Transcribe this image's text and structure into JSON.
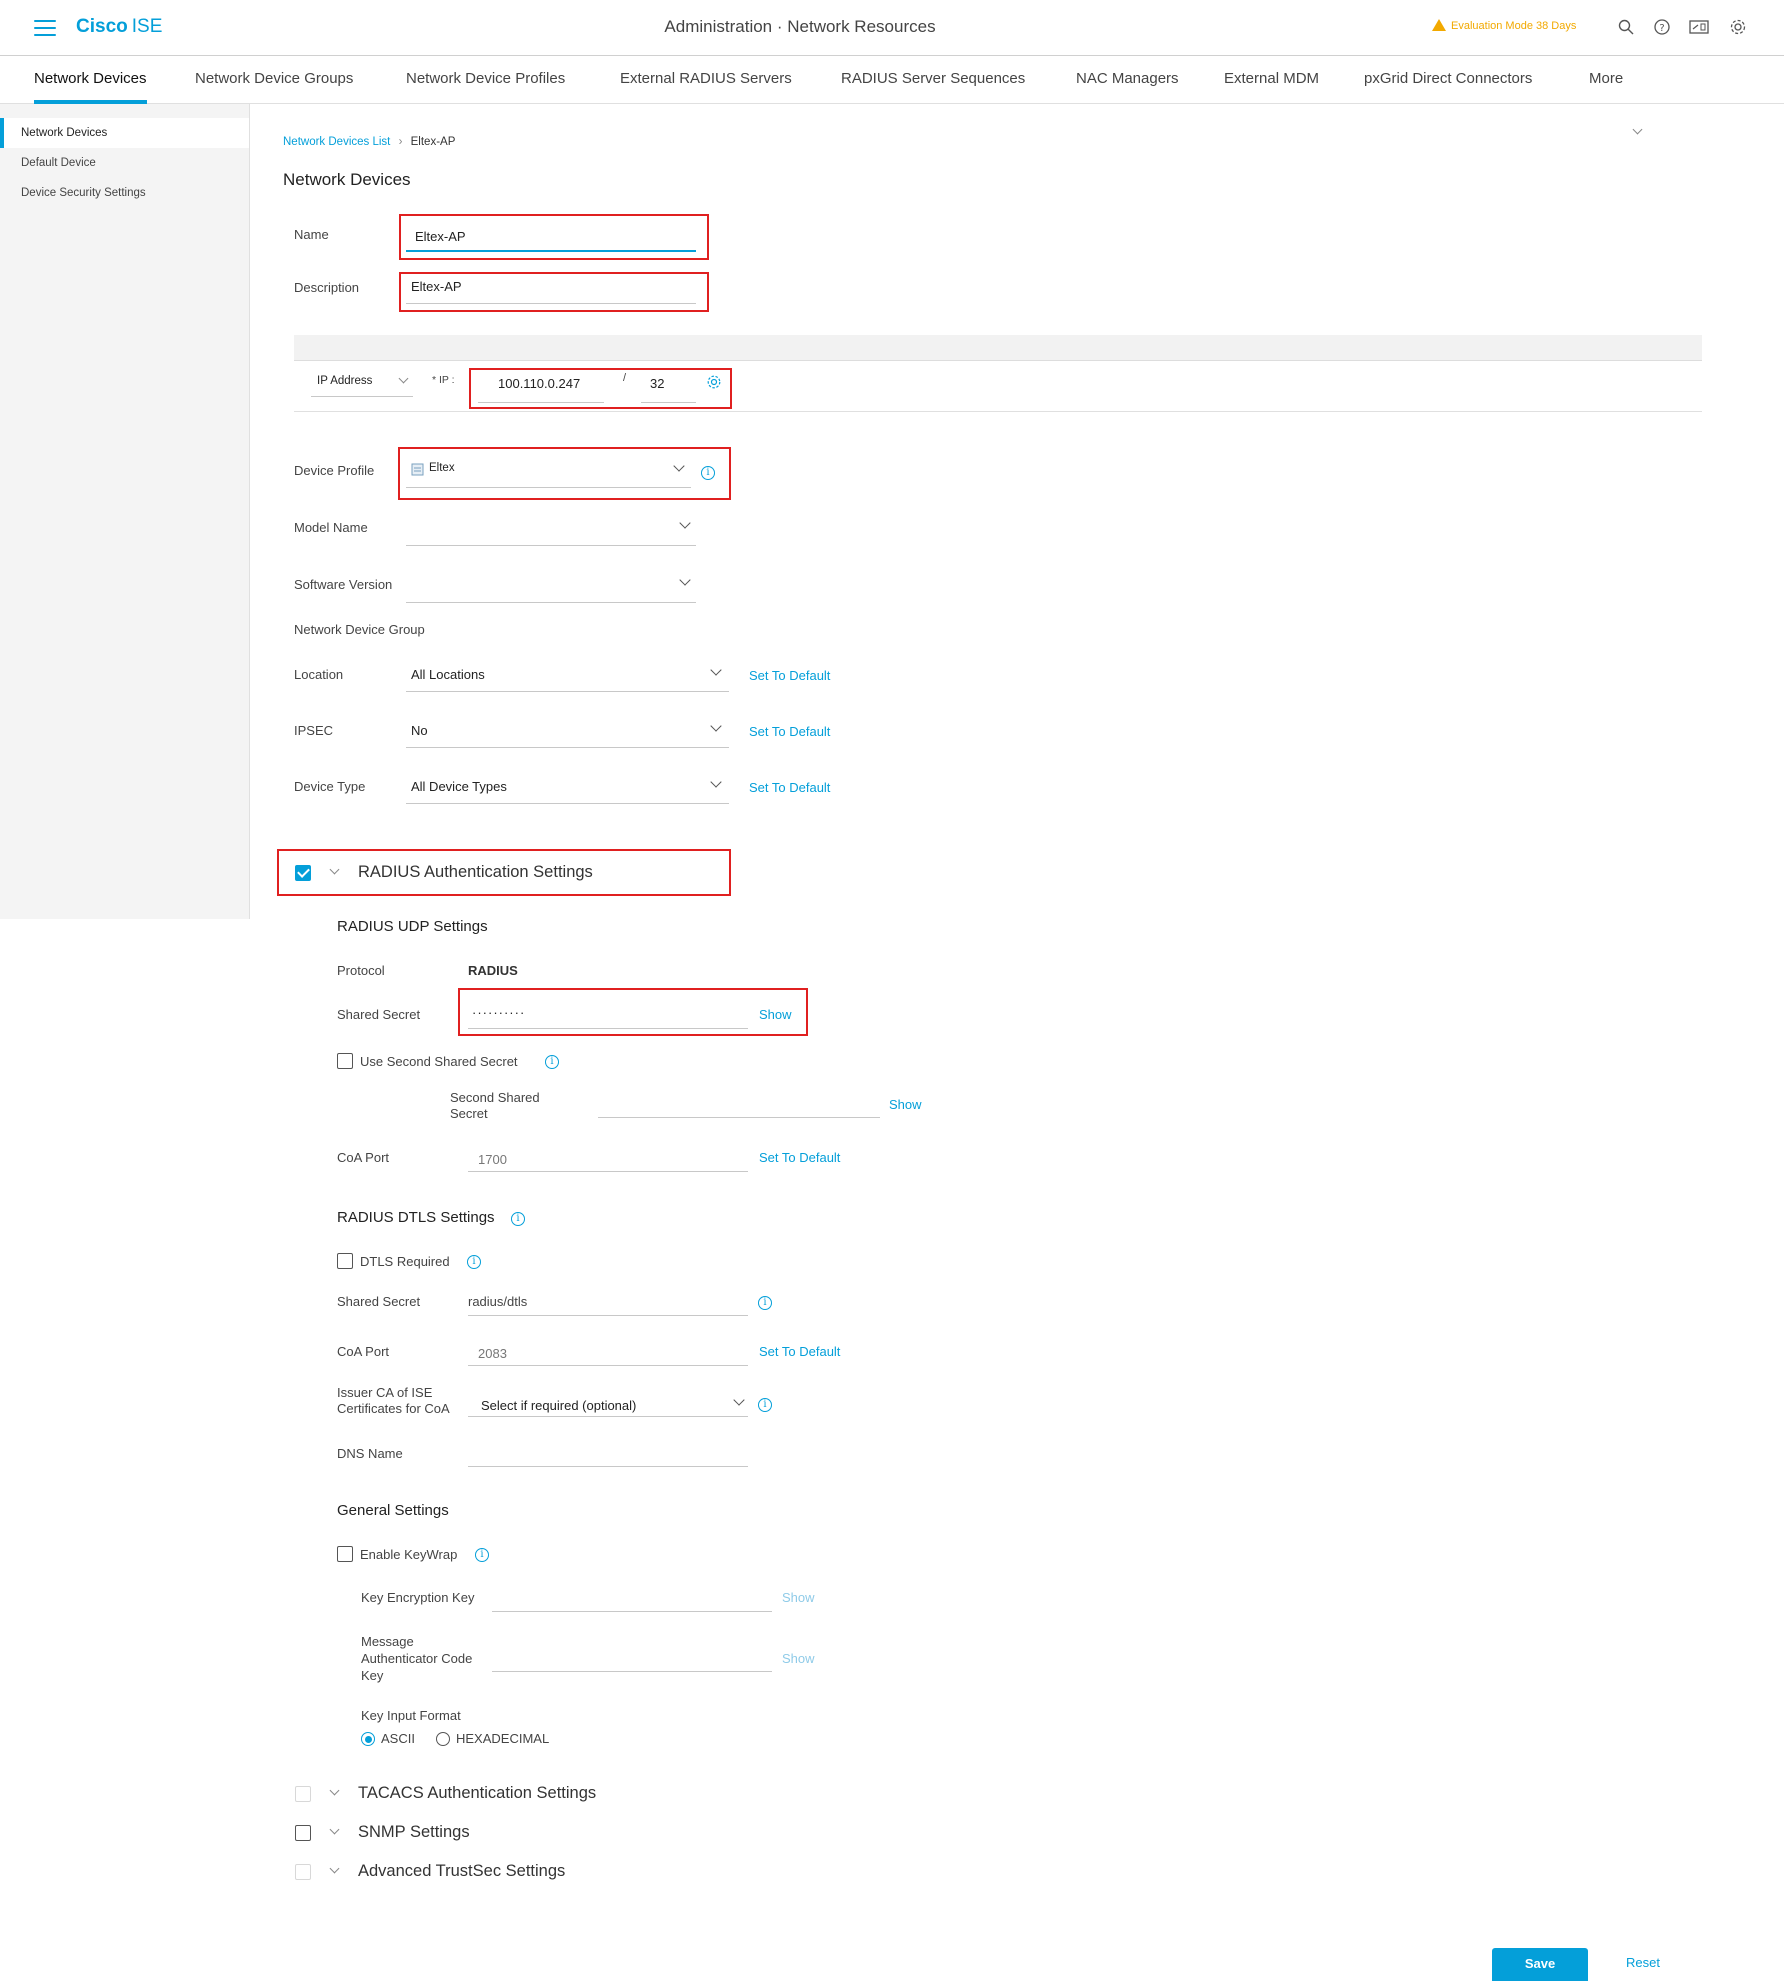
{
  "header": {
    "brand_bold": "Cisco",
    "brand_light": "ISE",
    "page_title": "Administration · Network Resources",
    "eval_text": "Evaluation Mode 38 Days",
    "icons": [
      "search-icon",
      "help-icon",
      "dashboard-icon",
      "gear-icon"
    ]
  },
  "tabs": [
    {
      "label": "Network Devices",
      "active": true
    },
    {
      "label": "Network Device Groups"
    },
    {
      "label": "Network Device Profiles"
    },
    {
      "label": "External RADIUS Servers"
    },
    {
      "label": "RADIUS Server Sequences"
    },
    {
      "label": "NAC Managers"
    },
    {
      "label": "External MDM"
    },
    {
      "label": "pxGrid Direct Connectors"
    },
    {
      "label": "More"
    }
  ],
  "sidebar": {
    "items": [
      {
        "label": "Network Devices",
        "active": true
      },
      {
        "label": "Default Device"
      },
      {
        "label": "Device Security Settings"
      }
    ]
  },
  "breadcrumb": {
    "parent": "Network Devices List",
    "current": "Eltex-AP"
  },
  "form": {
    "title": "Network Devices",
    "name_label": "Name",
    "name_value": "Eltex-AP",
    "description_label": "Description",
    "description_value": "Eltex-AP",
    "ip_type": "IP Address",
    "ip_label": "* IP :",
    "ip_value": "100.110.0.247",
    "ip_slash": "/",
    "mask_value": "32",
    "device_profile_label": "Device Profile",
    "device_profile_value": "Eltex",
    "model_name_label": "Model Name",
    "software_version_label": "Software Version",
    "ndg_label": "Network Device Group",
    "location_label": "Location",
    "location_value": "All Locations",
    "ipsec_label": "IPSEC",
    "ipsec_value": "No",
    "device_type_label": "Device Type",
    "device_type_value": "All Device Types",
    "set_default": "Set To Default"
  },
  "radius": {
    "section_title": "RADIUS Authentication Settings",
    "udp_title": "RADIUS UDP Settings",
    "protocol_label": "Protocol",
    "protocol_value": "RADIUS",
    "shared_secret_label": "Shared Secret",
    "shared_secret_value": "··········",
    "show": "Show",
    "use_second_label": "Use Second Shared Secret",
    "second_secret_label_1": "Second Shared",
    "second_secret_label_2": "Secret",
    "coa_port_label": "CoA Port",
    "coa_port_value": "1700",
    "set_default": "Set To Default",
    "dtls_title": "RADIUS DTLS Settings",
    "dtls_required_label": "DTLS Required",
    "dtls_shared_secret_label": "Shared Secret",
    "dtls_shared_secret_value": "radius/dtls",
    "dtls_coa_port_label": "CoA Port",
    "dtls_coa_port_value": "2083",
    "issuer_label_1": "Issuer CA of ISE",
    "issuer_label_2": "Certificates for CoA",
    "issuer_value": "Select if required (optional)",
    "dns_label": "DNS Name",
    "general_title": "General Settings",
    "keywrap_label": "Enable KeyWrap",
    "kek_label": "Key Encryption Key",
    "mack_label_1": "Message",
    "mack_label_2": "Authenticator Code",
    "mack_label_3": "Key",
    "key_input_format_label": "Key Input Format",
    "ascii_label": "ASCII",
    "hex_label": "HEXADECIMAL"
  },
  "sections": {
    "tacacs": "TACACS Authentication Settings",
    "snmp": "SNMP Settings",
    "trustsec": "Advanced TrustSec Settings"
  },
  "actions": {
    "save": "Save",
    "reset": "Reset"
  },
  "colors": {
    "accent": "#049fd9",
    "highlight": "#e02020",
    "warning": "#f2a900"
  }
}
